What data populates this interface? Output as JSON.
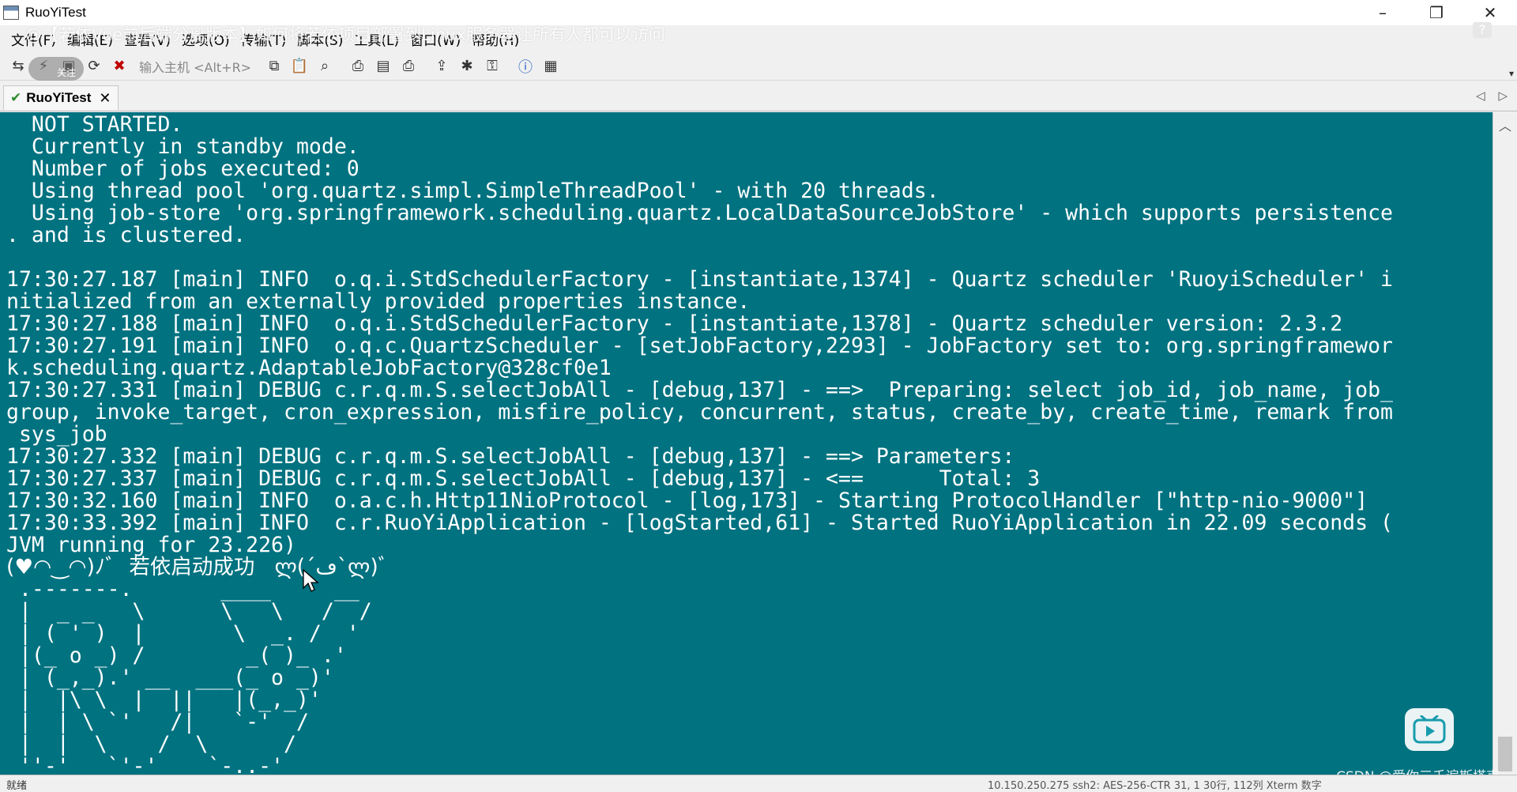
{
  "window": {
    "title": "RuoYiTest",
    "controls": {
      "minimize": "–",
      "maximize": "❐",
      "close": "✕"
    }
  },
  "overlay": {
    "video_title": "@【若依Vue前后端分离版本】如何将若依项目部署到Linux服务器让所有人都可以访问",
    "follow_label": "关注",
    "watermark": "CSDN @爱你三千遍斯塔克"
  },
  "menu": [
    "文件(F)",
    "编辑(E)",
    "查看(V)",
    "选项(O)",
    "传输(T)",
    "脚本(S)",
    "工具(L)",
    "窗口(W)",
    "帮助(H)"
  ],
  "toolbar": {
    "host_input_placeholder": "输入主机 <Alt+R>",
    "icons": [
      "connect-icon",
      "quick-connect-icon",
      "session-manager-icon",
      "reconnect-icon",
      "disconnect-icon",
      "copy-icon",
      "paste-icon",
      "find-icon",
      "print-setup-icon",
      "print-screen-icon",
      "print-icon",
      "sftp-icon",
      "settings-icon",
      "key-agent-icon",
      "help-icon",
      "map-icon"
    ]
  },
  "tab": {
    "label": "RuoYiTest",
    "close": "✕",
    "nav": "◁ ▷"
  },
  "terminal": {
    "lines": [
      "  NOT STARTED.",
      "  Currently in standby mode.",
      "  Number of jobs executed: 0",
      "  Using thread pool 'org.quartz.simpl.SimpleThreadPool' - with 20 threads.",
      "  Using job-store 'org.springframework.scheduling.quartz.LocalDataSourceJobStore' - which supports persistence",
      ". and is clustered.",
      "",
      "17:30:27.187 [main] INFO  o.q.i.StdSchedulerFactory - [instantiate,1374] - Quartz scheduler 'RuoyiScheduler' i",
      "nitialized from an externally provided properties instance.",
      "17:30:27.188 [main] INFO  o.q.i.StdSchedulerFactory - [instantiate,1378] - Quartz scheduler version: 2.3.2",
      "17:30:27.191 [main] INFO  o.q.c.QuartzScheduler - [setJobFactory,2293] - JobFactory set to: org.springframewor",
      "k.scheduling.quartz.AdaptableJobFactory@328cf0e1",
      "17:30:27.331 [main] DEBUG c.r.q.m.S.selectJobAll - [debug,137] - ==>  Preparing: select job_id, job_name, job_",
      "group, invoke_target, cron_expression, misfire_policy, concurrent, status, create_by, create_time, remark from",
      " sys_job",
      "17:30:27.332 [main] DEBUG c.r.q.m.S.selectJobAll - [debug,137] - ==> Parameters: ",
      "17:30:27.337 [main] DEBUG c.r.q.m.S.selectJobAll - [debug,137] - <==      Total: 3",
      "17:30:32.160 [main] INFO  o.a.c.h.Http11NioProtocol - [log,173] - Starting ProtocolHandler [\"http-nio-9000\"]",
      "17:30:33.392 [main] INFO  c.r.RuoYiApplication - [logStarted,61] - Started RuoYiApplication in 22.09 seconds (",
      "JVM running for 23.226)",
      "(♥◠‿◠)ﾉﾞ  若依启动成功   ლ(´ڡ`ლ)ﾞ",
      " .-------.       ____     __",
      " |  _ _   \\      \\   \\   /  /",
      " | ( ' )  |       \\  _. /  '",
      " |(_ o _) /        _( )_ .'",
      " | (_,_).' __  ___(_ o _)'",
      " |  |\\ \\  |  ||   |(_,_)'",
      " |  | \\ `'   /|   `-'  /",
      " |  |  \\    /  \\      /",
      " ''-'   `'-'    `-..-'"
    ]
  },
  "status": {
    "left": "就绪",
    "right": "10.150.250.275   ssh2: AES-256-CTR   31,  1   30行, 112列   Xterm   数字"
  }
}
